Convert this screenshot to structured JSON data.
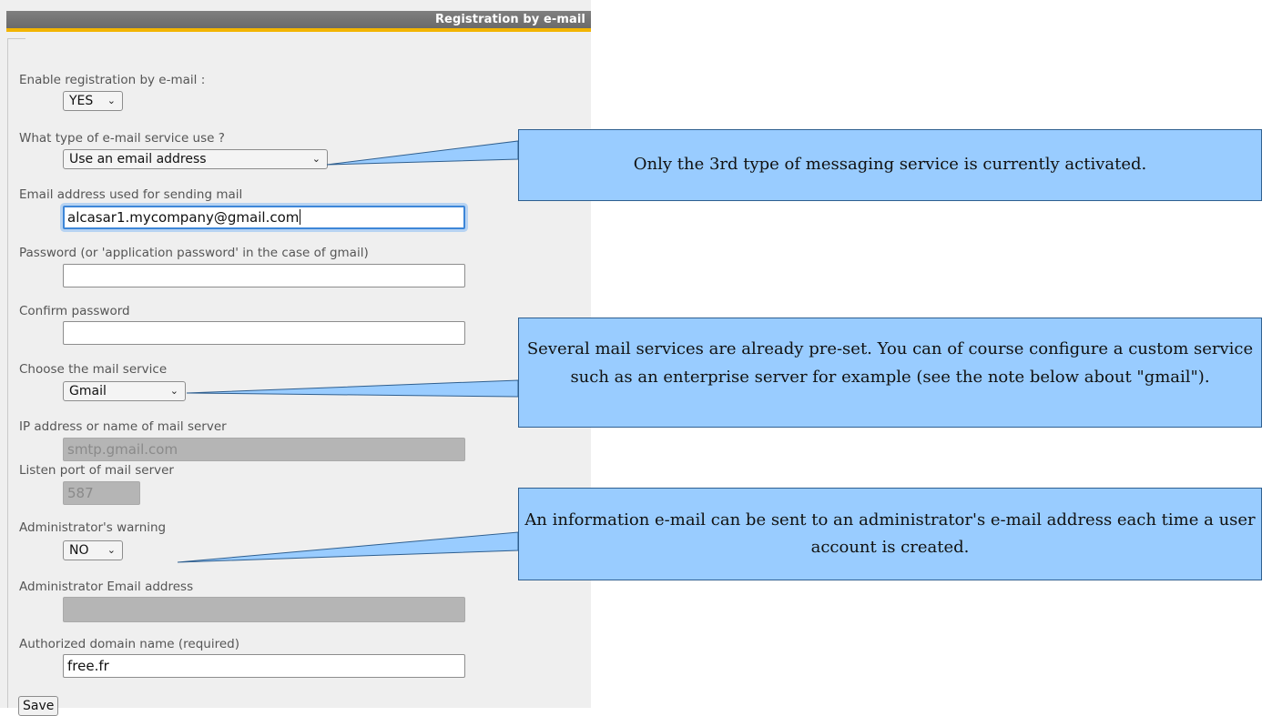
{
  "header": {
    "title": "Registration by e-mail"
  },
  "form": {
    "enable": {
      "label": "Enable registration by e-mail :",
      "value": "YES"
    },
    "service_type": {
      "label": "What type of e-mail service use ?",
      "value": "Use an email address"
    },
    "sender_email": {
      "label": "Email address used for sending mail",
      "value": "alcasar1.mycompany@gmail.com"
    },
    "password": {
      "label": "Password (or 'application password' in the case of gmail)",
      "value": ""
    },
    "confirm_password": {
      "label": "Confirm password",
      "value": ""
    },
    "mail_service": {
      "label": "Choose the mail service",
      "value": "Gmail"
    },
    "mail_server": {
      "label": "IP address or name of mail server",
      "value": "smtp.gmail.com"
    },
    "port": {
      "label": "Listen port of mail server",
      "value": "587"
    },
    "admin_warning": {
      "label": "Administrator's warning",
      "value": "NO"
    },
    "admin_email": {
      "label": "Administrator Email address",
      "value": ""
    },
    "domain": {
      "label": "Authorized domain name (required)",
      "value": "free.fr"
    },
    "save_label": "Save"
  },
  "callouts": {
    "service_type": "Only the 3rd type of messaging service is currently activated.",
    "mail_service": "Several mail services are already pre-set. You can of course configure a custom service such as an enterprise server for example (see the note below about \"gmail\").",
    "admin_warning": "An information e-mail can be sent to an administrator's e-mail address each time a user account is created."
  },
  "colors": {
    "header_bg": "#727272",
    "header_accent": "#f2b400",
    "panel_bg": "#efefef",
    "callout_bg": "#99ccff",
    "focus_ring": "#3d86d8"
  },
  "icons": {
    "select_arrow": "chevron-down-icon"
  }
}
